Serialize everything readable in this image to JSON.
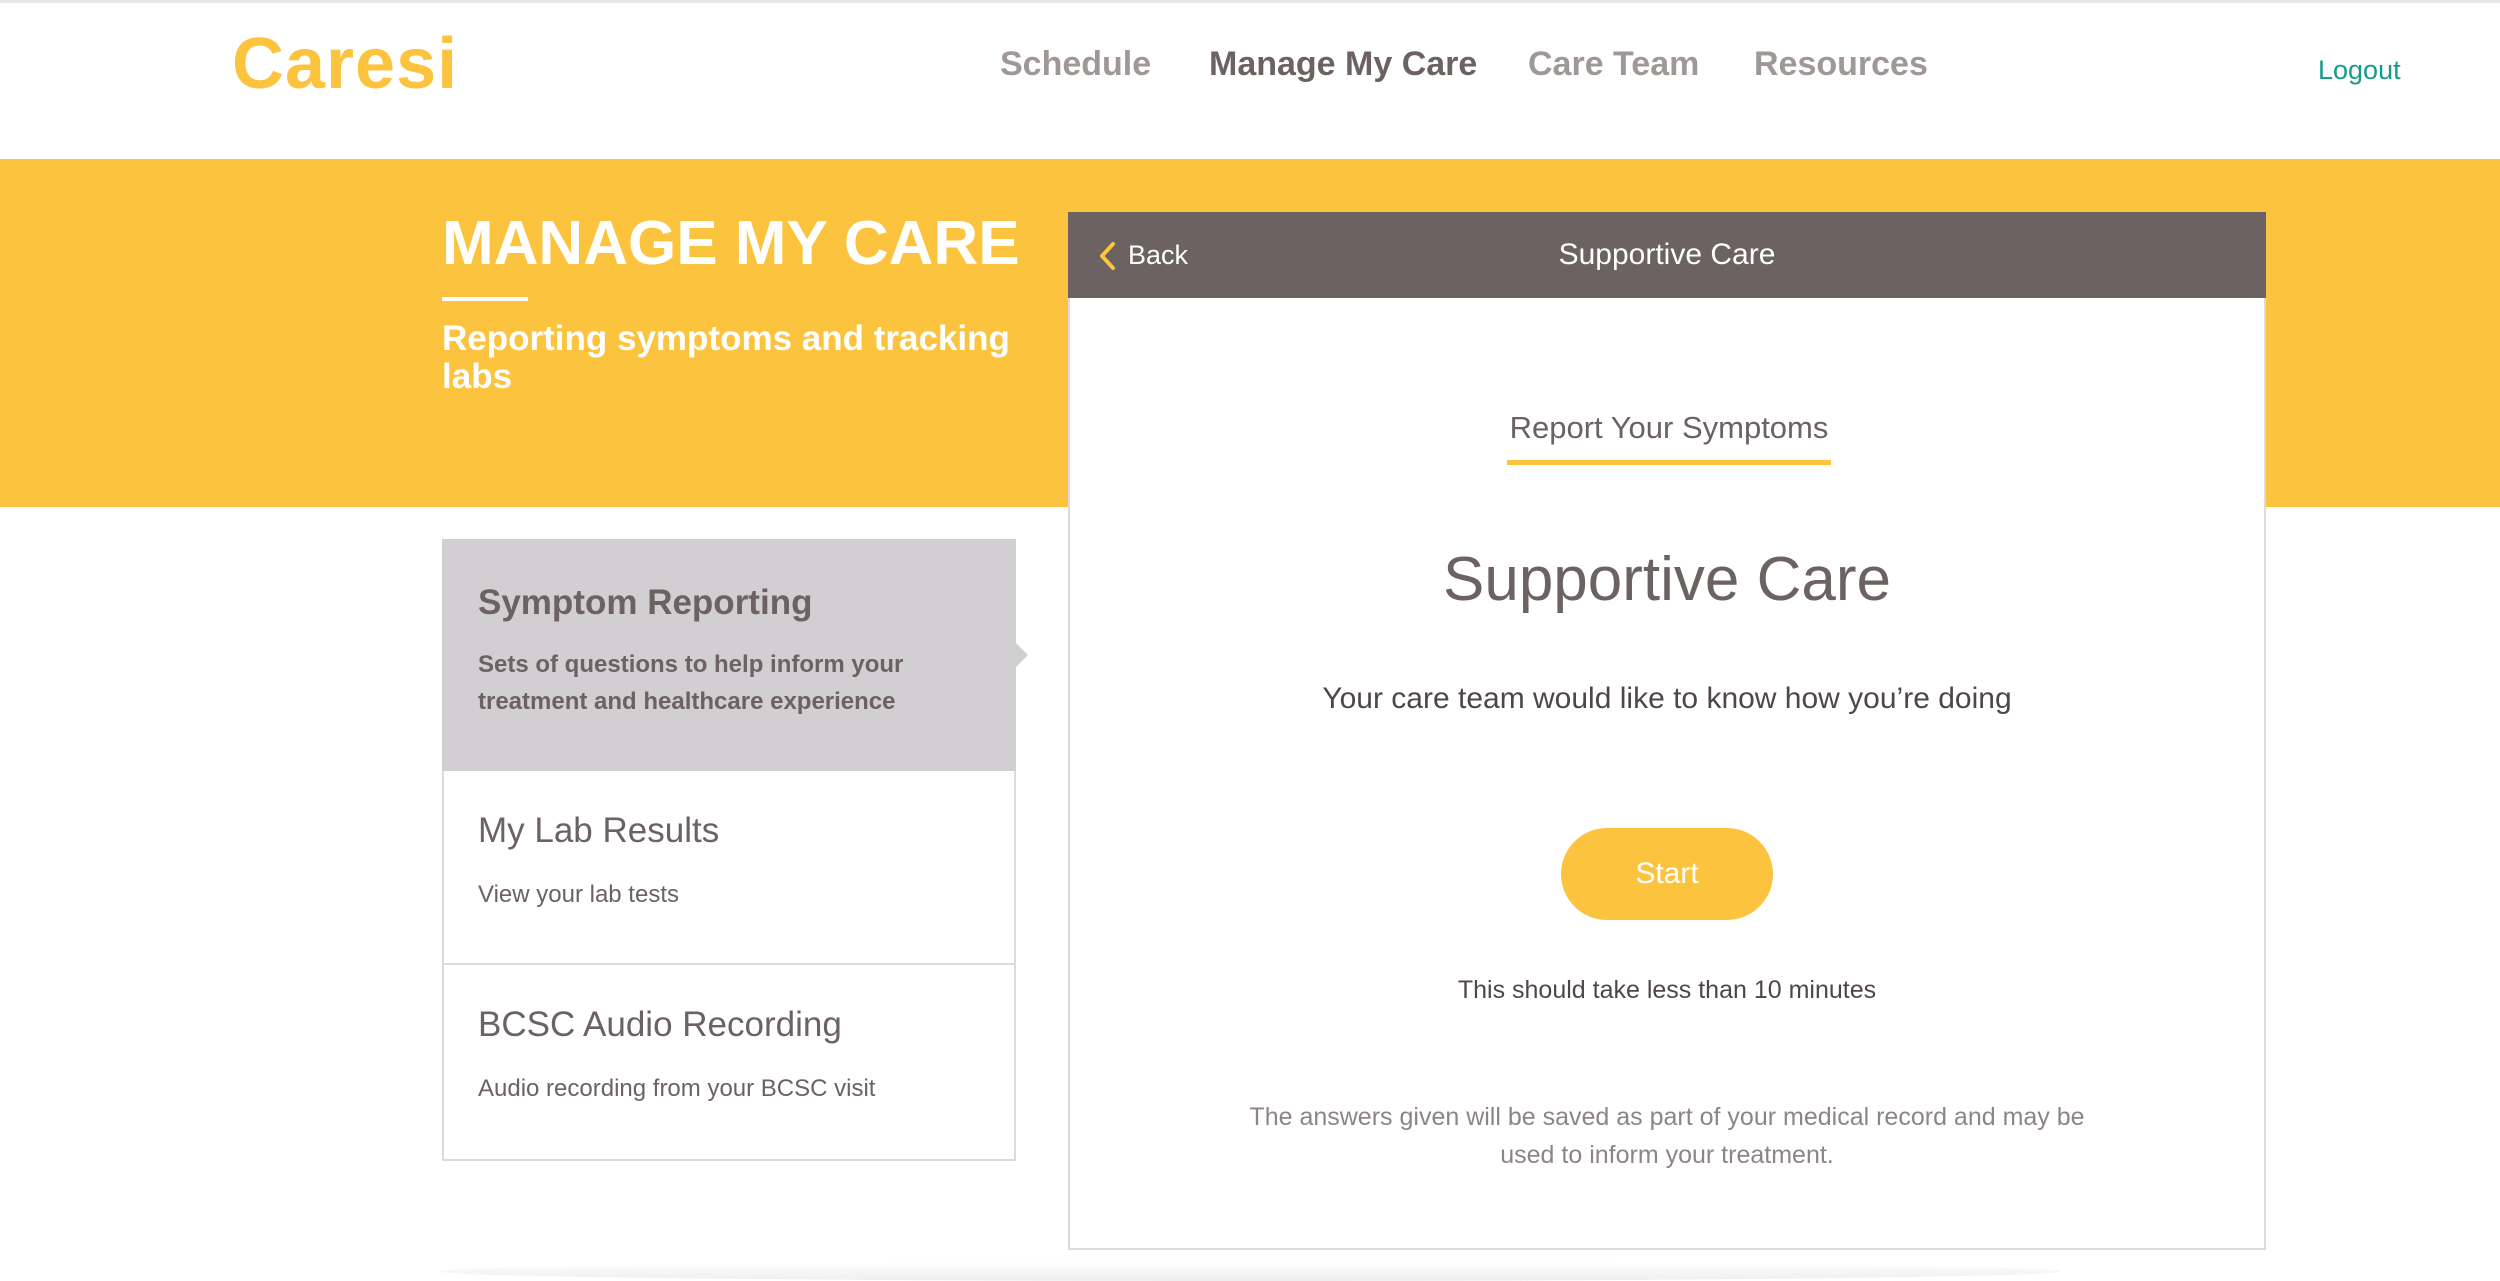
{
  "header": {
    "logo": "Caresi",
    "nav": [
      {
        "label": "Schedule"
      },
      {
        "label": "Manage My Care"
      },
      {
        "label": "Care Team"
      },
      {
        "label": "Resources"
      }
    ],
    "active_nav": "Manage My Care",
    "logout": "Logout"
  },
  "banner": {
    "title": "MANAGE MY CARE",
    "subtitle": "Reporting symptoms and tracking labs"
  },
  "sidebar": {
    "items": [
      {
        "title": "Symptom Reporting",
        "description": "Sets of questions to help inform your treatment and healthcare experience"
      },
      {
        "title": "My Lab Results",
        "description": "View your lab tests"
      },
      {
        "title": "BCSC Audio Recording",
        "description": "Audio recording from your BCSC visit"
      }
    ],
    "active_item": "Symptom Reporting"
  },
  "panel": {
    "back_label": "Back",
    "title": "Supportive Care",
    "tab_label": "Report Your Symptoms",
    "heading": "Supportive Care",
    "lead": "Your care team would like to know how you’re doing",
    "start_label": "Start",
    "duration": "This should take less than 10 minutes",
    "disclaimer": "The answers given will be saved as part of your medical record and may be used to inform your treatment."
  },
  "colors": {
    "brand_yellow": "#fcc43e",
    "panel_header": "#6b6261",
    "logout_teal": "#169c8c",
    "active_item_bg": "#d1cfd2"
  },
  "icons": {
    "back": "chevron-left-icon"
  }
}
